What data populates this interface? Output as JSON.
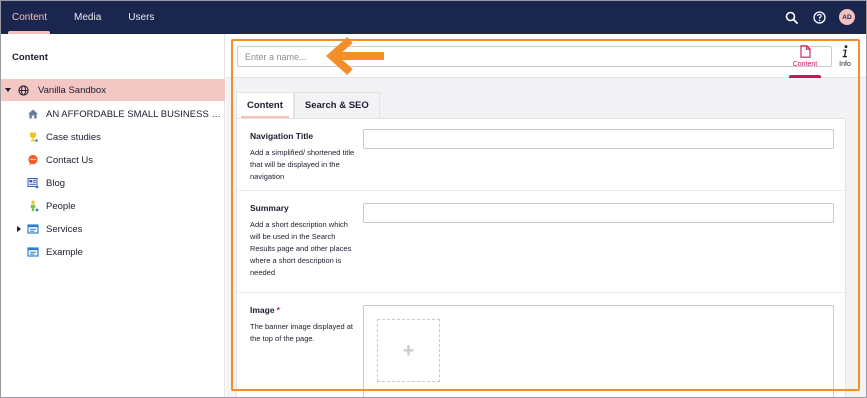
{
  "topbar": {
    "nav": [
      {
        "label": "Content",
        "active": true
      },
      {
        "label": "Media",
        "active": false
      },
      {
        "label": "Users",
        "active": false
      }
    ],
    "avatar_initials": "AD"
  },
  "sidebar": {
    "title": "Content",
    "root": {
      "label": "Vanilla Sandbox",
      "icon": "globe-icon"
    },
    "items": [
      {
        "label": "AN AFFORDABLE SMALL BUSINESS W...",
        "icon": "home-icon"
      },
      {
        "label": "Case studies",
        "icon": "trophy-icon"
      },
      {
        "label": "Contact Us",
        "icon": "chat-icon"
      },
      {
        "label": "Blog",
        "icon": "blog-icon"
      },
      {
        "label": "People",
        "icon": "person-icon"
      },
      {
        "label": "Services",
        "icon": "window-icon",
        "expandable": true
      },
      {
        "label": "Example",
        "icon": "window-icon"
      }
    ]
  },
  "editor": {
    "name_placeholder": "Enter a name...",
    "app_tabs": [
      {
        "label": "Content",
        "icon": "document-icon",
        "active": true
      },
      {
        "label": "Info",
        "icon": "info-icon",
        "active": false
      }
    ],
    "content_tabs": [
      {
        "label": "Content",
        "active": true
      },
      {
        "label": "Search & SEO",
        "active": false
      }
    ],
    "properties": [
      {
        "label": "Navigation Title",
        "description": "Add a simplified/ shortened title that will be displayed in the navigation",
        "required": false
      },
      {
        "label": "Summary",
        "description": "Add a short description which will be used in the Search Results page and other places where a short description is needed",
        "required": false
      },
      {
        "label": "Image",
        "description": "The banner image displayed at the top of the page.",
        "required": true,
        "required_mark": "*"
      }
    ],
    "media_add_symbol": "+"
  },
  "colors": {
    "topbar": "#1b264f",
    "active_nav": "#f5c1bc",
    "selected_tree": "#f3c7c4",
    "accent": "#c2185b",
    "annotation": "#f28f29"
  }
}
